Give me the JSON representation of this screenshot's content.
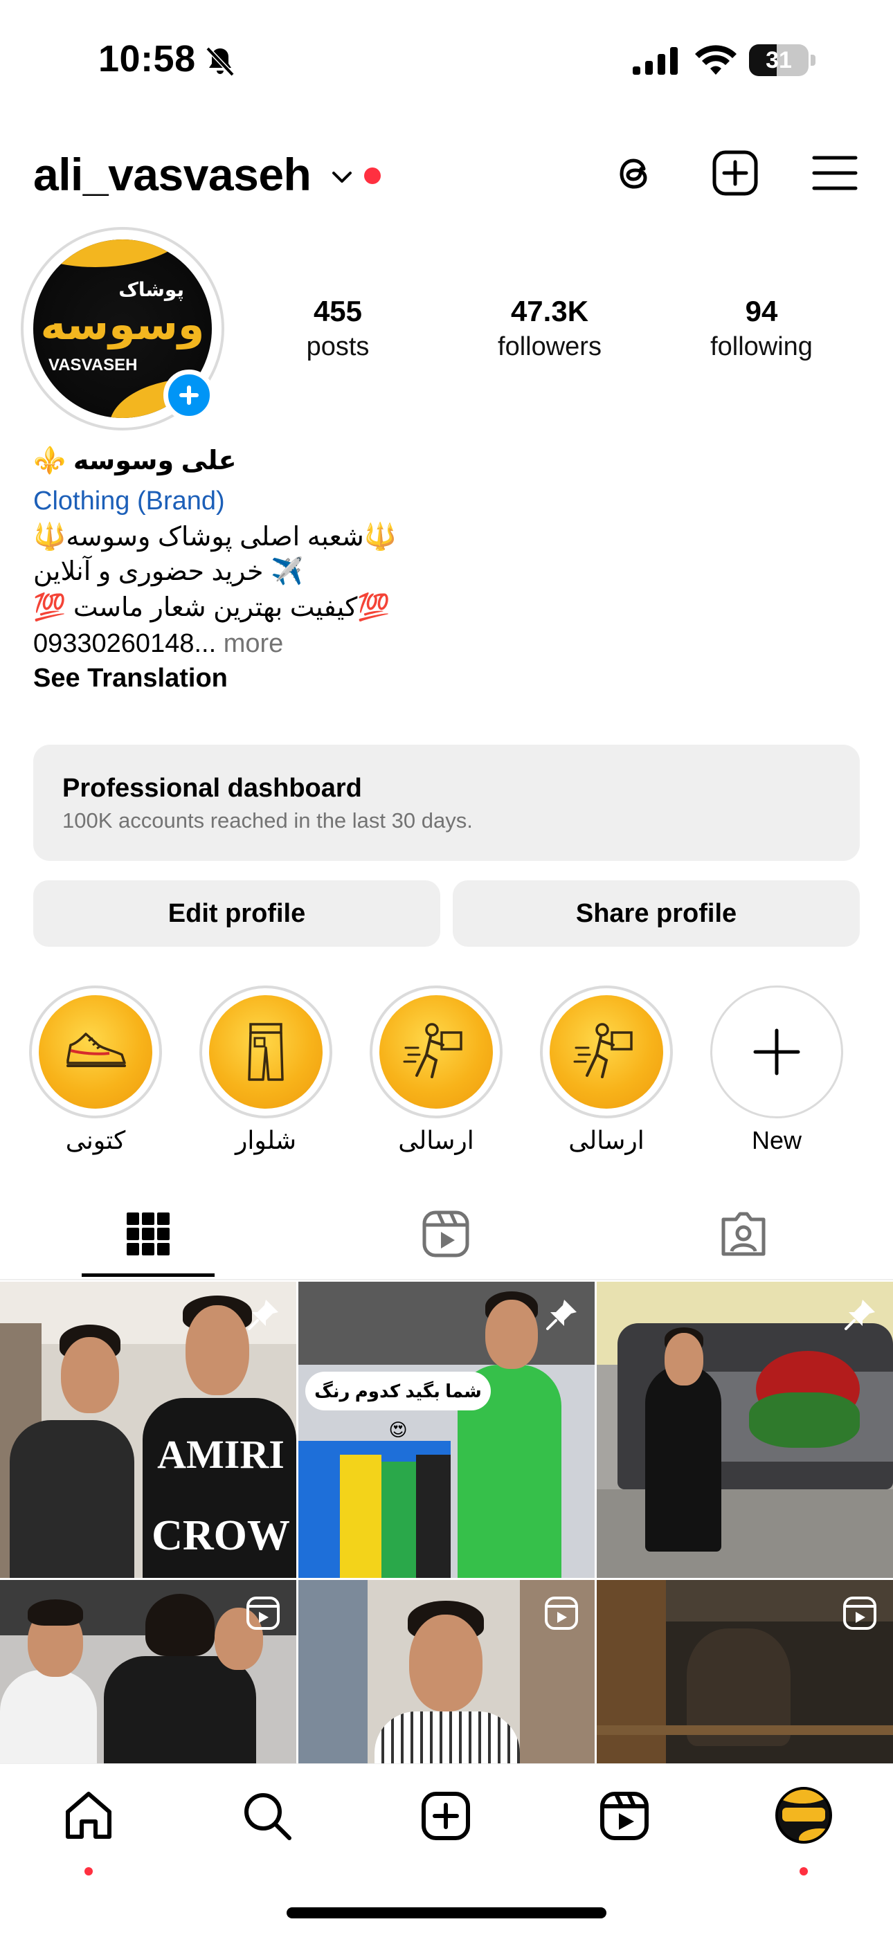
{
  "status_bar": {
    "time": "10:58",
    "battery": "31"
  },
  "header": {
    "username": "ali_vasvaseh"
  },
  "avatar": {
    "brand_top": "پوشاک",
    "brand_main": "وسوسه",
    "brand_sub": "VASVASEH"
  },
  "stats": [
    {
      "value": "455",
      "label": "posts"
    },
    {
      "value": "47.3K",
      "label": "followers"
    },
    {
      "value": "94",
      "label": "following"
    }
  ],
  "bio": {
    "name": "علی وسوسه ⚜️",
    "category": "Clothing (Brand)",
    "line1": "🔱شعبه اصلی پوشاک وسوسه🔱",
    "line2": "✈️ خرید حضوری و آنلاین",
    "line3": "💯کیفیت بهترین شعار ماست 💯",
    "phone": "09330260148...",
    "more": " more",
    "see_translation": "See Translation"
  },
  "dashboard": {
    "title": "Professional dashboard",
    "subtitle": "100K accounts reached in the last 30 days."
  },
  "buttons": {
    "edit_profile": "Edit profile",
    "share_profile": "Share profile"
  },
  "highlights": [
    {
      "label": "کتونی",
      "icon": "sneaker-icon"
    },
    {
      "label": "شلوار",
      "icon": "pants-icon"
    },
    {
      "label": "ارسالی",
      "icon": "delivery-icon"
    },
    {
      "label": "ارسالی",
      "icon": "delivery-icon"
    },
    {
      "label": "New",
      "icon": "plus-icon"
    }
  ],
  "tabs": [
    {
      "icon": "grid-icon",
      "active": true
    },
    {
      "icon": "reels-icon",
      "active": false
    },
    {
      "icon": "tagged-icon",
      "active": false
    }
  ],
  "grid": {
    "post2_caption": "شما بگید کدوم رنگ 😍",
    "post1_shirt_text": "AMIRI",
    "post1_shirt_text2": "CROW"
  },
  "colors": {
    "accent_blue": "#0095f6",
    "notification_red": "#ff3040",
    "highlight_gold": "#f8b31a",
    "link_blue": "#1c5fb8"
  }
}
